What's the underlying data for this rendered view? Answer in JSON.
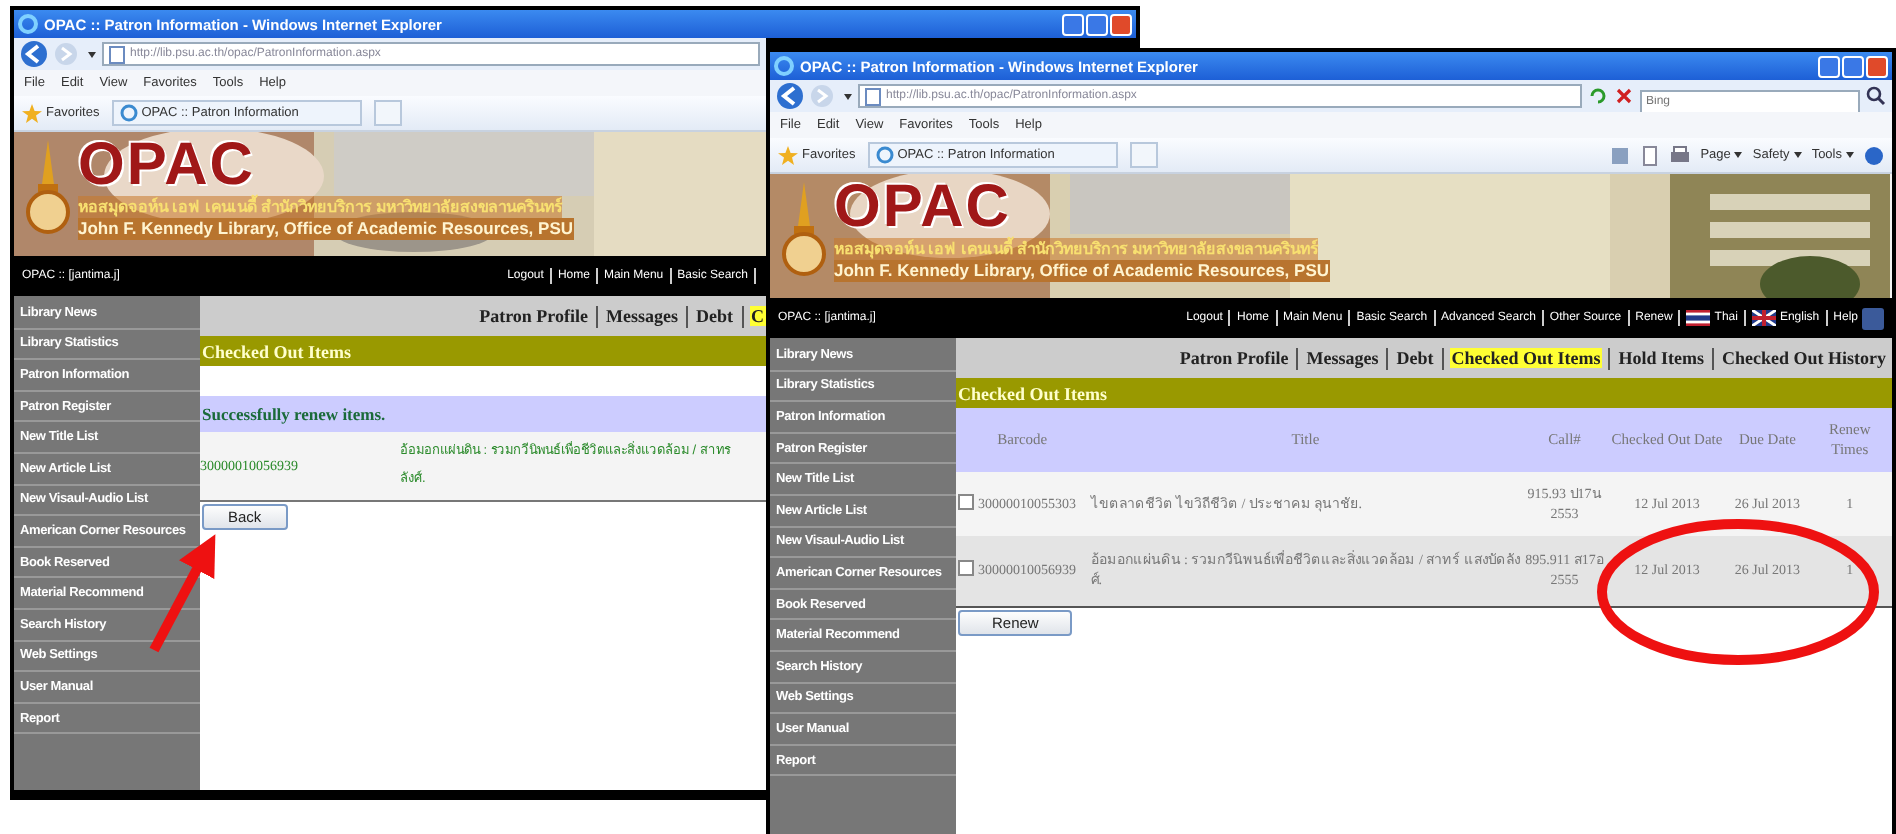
{
  "windows": [
    {
      "title": "OPAC :: Patron Information - Windows Internet Explorer",
      "address": "http://lib.psu.ac.th/opac/PatronInformation.aspx",
      "menu": [
        "File",
        "Edit",
        "View",
        "Favorites",
        "Tools",
        "Help"
      ],
      "favorites": "Favorites",
      "tab": "OPAC :: Patron Information",
      "banner": {
        "logo": "OPAC",
        "thai_name": "หอสมุดจอห์น เอฟ เคนเนดี้ สำนักวิทยบริการ มหาวิทยาลัยสงขลานครินทร์",
        "english_name": "John F. Kennedy Library, Office of Academic Resources, PSU"
      },
      "user": "OPAC :: [jantima.j]",
      "top_links": [
        {
          "label": "Logout"
        },
        {
          "label": "Home"
        },
        {
          "label": "Main Menu"
        },
        {
          "label": "Basic Search"
        }
      ],
      "top_links_trailing_divider": true,
      "sidebar": [
        "Library News",
        "Library Statistics",
        "Patron Information",
        "Patron Register",
        "New Title List",
        "New Article List",
        "New Visaul-Audio List",
        "American Corner Resources",
        "Book Reserved",
        "Material Recommend",
        "Search History",
        "Web Settings",
        "User Manual",
        "Report"
      ],
      "patron_nav": [
        {
          "label": "Patron Profile",
          "selected": false
        },
        {
          "label": "Messages",
          "selected": false
        },
        {
          "label": "Debt",
          "selected": false
        },
        {
          "label": "C",
          "selected": true
        }
      ],
      "section_title": "Checked Out Items",
      "message": "Successfully renew items.",
      "results": [
        {
          "barcode": "30000010056939",
          "title_lines": [
            "อ้อมอกแผ่นดิน : รวมกวีนิพนธ์เพื่อชีวิตและสิ่งแวดล้อม / สาทร",
            "ลังศ์."
          ]
        }
      ],
      "button": "Back"
    },
    {
      "title": "OPAC :: Patron Information - Windows Internet Explorer",
      "address": "http://lib.psu.ac.th/opac/PatronInformation.aspx",
      "search_placeholder": "Bing",
      "menu": [
        "File",
        "Edit",
        "View",
        "Favorites",
        "Tools",
        "Help"
      ],
      "favorites": "Favorites",
      "tab": "OPAC :: Patron Information",
      "commands": [
        "Page",
        "Safety",
        "Tools"
      ],
      "banner": {
        "logo": "OPAC",
        "thai_name": "หอสมุดจอห์น เอฟ เคนเนดี้ สำนักวิทยบริการ มหาวิทยาลัยสงขลานครินทร์",
        "english_name": "John F. Kennedy Library, Office of Academic Resources, PSU"
      },
      "user": "OPAC :: [jantima.j]",
      "top_links": [
        {
          "label": "Logout"
        },
        {
          "label": "Home"
        },
        {
          "label": "Main Menu"
        },
        {
          "label": "Basic Search"
        },
        {
          "label": "Advanced Search"
        },
        {
          "label": "Other Source"
        },
        {
          "label": "Renew"
        },
        {
          "label": "Thai",
          "kind": "striped-flag"
        },
        {
          "label": "English",
          "kind": "crossed-flag"
        },
        {
          "label": "Help",
          "kind": "social"
        }
      ],
      "sidebar": [
        "Library News",
        "Library Statistics",
        "Patron Information",
        "Patron Register",
        "New Title List",
        "New Article List",
        "New Visaul-Audio List",
        "American Corner Resources",
        "Book Reserved",
        "Material Recommend",
        "Search History",
        "Web Settings",
        "User Manual",
        "Report"
      ],
      "patron_nav": [
        {
          "label": "Patron Profile",
          "selected": false
        },
        {
          "label": "Messages",
          "selected": false
        },
        {
          "label": "Debt",
          "selected": false
        },
        {
          "label": "Checked Out Items",
          "selected": true
        },
        {
          "label": "Hold Items",
          "selected": false
        },
        {
          "label": "Checked Out History",
          "selected": false
        }
      ],
      "section_title": "Checked Out Items",
      "table": {
        "columns": [
          "Barcode",
          "Title",
          "Call#",
          "Checked Out Date",
          "Due Date",
          "Renew Times"
        ],
        "rows": [
          {
            "checked": false,
            "barcode": "30000010055303",
            "title": "ไขตลาดชีวิต ไขวิถีชีวิต / ประชาคม ลุนาชัย.",
            "call": "915.93 ป17น 2553",
            "checked_out": "12 Jul 2013",
            "due": "26 Jul 2013",
            "renew": "1"
          },
          {
            "checked": false,
            "barcode": "30000010056939",
            "title": "อ้อมอกแผ่นดิน : รวมกวีนิพนธ์เพื่อชีวิตและสิ่งแวดล้อม / สาทร์ แสงบัดลังศ์.",
            "call": "895.911 ส17อ 2555",
            "checked_out": "12 Jul 2013",
            "due": "26 Jul 2013",
            "renew": "1"
          }
        ]
      },
      "button": "Renew"
    }
  ]
}
